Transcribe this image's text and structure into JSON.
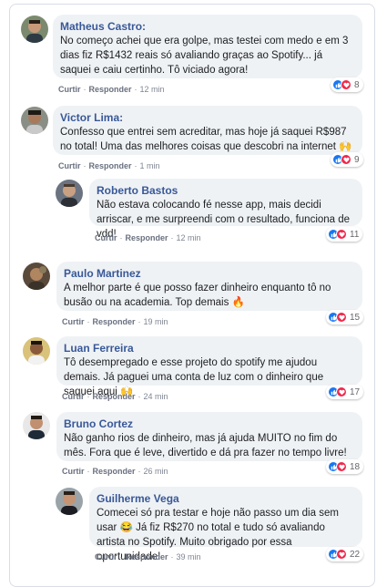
{
  "actions": {
    "like": "Curtir",
    "reply": "Responder",
    "sep": "·"
  },
  "comments": [
    {
      "name": "Matheus Castro:",
      "text": "No começo achei que era golpe, mas testei com medo e em 3 dias fiz R$1432 reais só avaliando graças ao Spotify... já saquei e caiu certinho. Tô viciado agora!",
      "time": "12 min",
      "count": "8"
    },
    {
      "name": "Victor Lima:",
      "text": "Confesso que entrei sem acreditar, mas hoje já saquei R$987 no total! Uma das melhores coisas que descobri na internet 🙌",
      "time": "1 min",
      "count": "9"
    },
    {
      "name": "Roberto Bastos",
      "text": "Não estava colocando fé nesse app, mais decidi arriscar, e me surpreendi com o resultado, funciona de vdd!",
      "time": "12 min",
      "count": "11"
    },
    {
      "name": "Paulo Martinez",
      "text": "A melhor parte é que posso fazer dinheiro enquanto tô no busão ou na academia. Top demais 🔥",
      "time": "19 min",
      "count": "15"
    },
    {
      "name": "Luan Ferreira",
      "text": "Tô desempregado e esse projeto do spotify me ajudou demais. Já paguei uma conta de luz com o dinheiro que saquei aqui 🙌",
      "time": "24 min",
      "count": "17"
    },
    {
      "name": "Bruno Cortez",
      "text": "Não ganho rios de dinheiro, mas já ajuda MUITO no fim do mês. Fora que é leve, divertido e dá pra fazer no tempo livre!",
      "time": "26 min",
      "count": "18"
    },
    {
      "name": "Guilherme Vega",
      "text": "Comecei só pra testar e hoje não passo um dia sem usar 😂 Já fiz R$270 no total e tudo só avaliando artista no Spotify. Muito obrigado por essa oportunidade!",
      "time": "39 min",
      "count": "22"
    }
  ],
  "colors": {
    "name": "#385898",
    "bubble": "#eff2f5",
    "like": "#1877f2",
    "love": "#f0284a"
  }
}
